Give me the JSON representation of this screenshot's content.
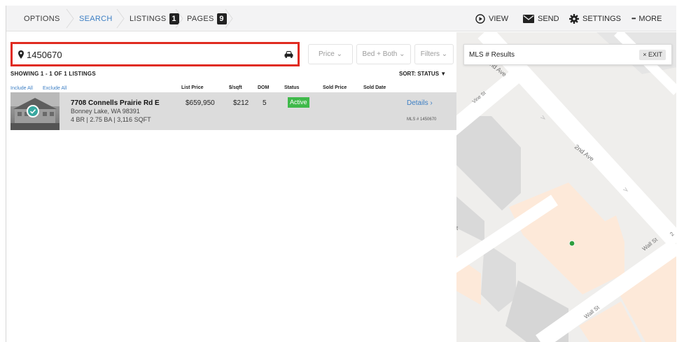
{
  "nav": {
    "options": "OPTIONS",
    "search": "SEARCH",
    "listings": "LISTINGS",
    "listings_count": "1",
    "pages": "PAGES",
    "pages_count": "9"
  },
  "toolbar": {
    "view": "VIEW",
    "send": "SEND",
    "settings": "SETTINGS",
    "more": "MORE",
    "more_dots": "•••"
  },
  "search": {
    "value": "1450670"
  },
  "filters": {
    "price": "Price ⌄",
    "bed_bath": "Bed + Both ⌄",
    "filters": "Filters ⌄"
  },
  "results": {
    "showing": "SHOWING 1 - 1 OF 1 LISTINGS",
    "sort": "SORT: STATUS ▼",
    "include_all": "Include All",
    "exclude_all": "Exclude All",
    "columns": {
      "list_price": "List Price",
      "per_sqft": "$/sqft",
      "dom": "DOM",
      "status": "Status",
      "sold_price": "Sold Price",
      "sold_date": "Sold Date"
    }
  },
  "listing": {
    "address": "7708 Connells Prairie Rd E",
    "city": "Bonney Lake, WA 98391",
    "specs": "4 BR | 2.75 BA | 3,116 SQFT",
    "list_price": "$659,950",
    "per_sqft": "$212",
    "dom": "5",
    "status": "Active",
    "details": "Details ›",
    "mls": "MLS # 1450670"
  },
  "map_panel": {
    "title": "MLS # Results",
    "exit": "× EXIT"
  },
  "map": {
    "labels": {
      "ave_top": "2nd Ave",
      "vine": "Vine St",
      "ave_mid": "2nd Ave",
      "wall1": "Wall St",
      "wall2": "Wall St",
      "right_edge": "2",
      "t": "t"
    }
  },
  "colors": {
    "accent": "#3d7fc4",
    "highlight_border": "#e02b20",
    "status_active": "#3fb94a",
    "map_marker": "#2e9e3e"
  }
}
